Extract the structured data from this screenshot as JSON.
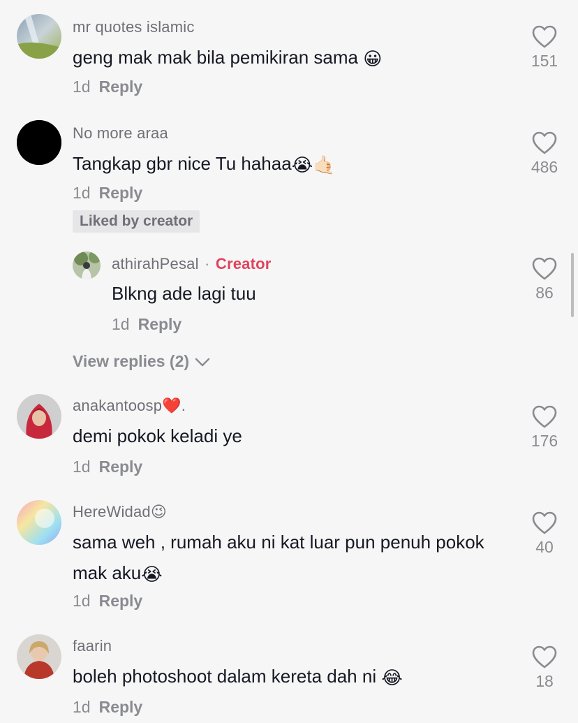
{
  "comments": [
    {
      "username": "mr quotes islamic",
      "text": "geng mak mak bila pemikiran sama",
      "emoji": "😀",
      "age": "1d",
      "reply": "Reply",
      "likes": "151",
      "avatar_icon": "waterfall-avatar"
    },
    {
      "username": "No more araa",
      "text": "Tangkap gbr nice Tu hahaa",
      "emoji": "😭🤙🏻",
      "age": "1d",
      "reply": "Reply",
      "likes": "486",
      "avatar_icon": "black-circle-avatar",
      "liked_badge": "Liked by creator"
    },
    {
      "username": "anakantoosp",
      "username_suffix": "❤️.",
      "text": "demi pokok keladi ye",
      "age": "1d",
      "reply": "Reply",
      "likes": "176",
      "avatar_icon": "hijab-portrait-avatar"
    },
    {
      "username": "HereWidad",
      "username_suffix": "😉",
      "text": "sama weh , rumah aku ni kat luar pun penuh pokok mak aku",
      "emoji": "😭",
      "age": "1d",
      "reply": "Reply",
      "likes": "40",
      "avatar_icon": "gradient-avatar"
    },
    {
      "username": "faarin",
      "text": "boleh photoshoot dalam kereta dah ni",
      "emoji": "😂",
      "age": "1d",
      "reply": "Reply",
      "likes": "18",
      "avatar_icon": "portrait-avatar"
    }
  ],
  "reply": {
    "username": "athirahPesal",
    "separator": "·",
    "creator_label": "Creator",
    "text": "Blkng ade lagi tuu",
    "age": "1d",
    "reply": "Reply",
    "likes": "86",
    "avatar_icon": "outdoor-portrait-avatar"
  },
  "view_replies": "View replies (2)",
  "colors": {
    "background": "#f6f6f6",
    "creator": "#e0425c",
    "muted": "#8a8b91"
  }
}
